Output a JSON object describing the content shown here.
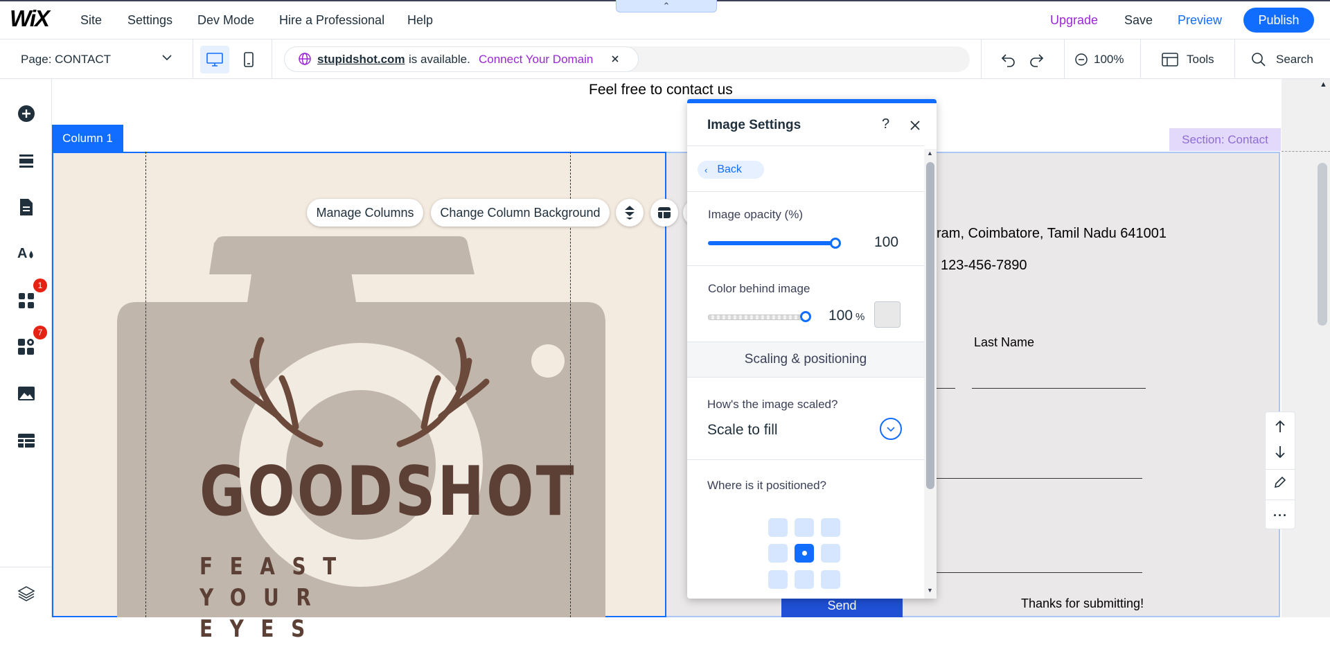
{
  "topbar": {
    "logo": "WiX",
    "menu": [
      "Site",
      "Settings",
      "Dev Mode",
      "Hire a Professional",
      "Help"
    ],
    "upgrade": "Upgrade",
    "save": "Save",
    "preview": "Preview",
    "publish": "Publish"
  },
  "subbar": {
    "page_label": "Page: CONTACT",
    "domain_name": "stupidshot.com",
    "domain_status": "is available.",
    "connect_domain": "Connect Your Domain",
    "zoom": "100%",
    "tools": "Tools",
    "search": "Search"
  },
  "sidebar": {
    "badges": {
      "apps": "1",
      "business": "7"
    }
  },
  "canvas": {
    "heading": "Feel free to contact us",
    "column_tag": "Column 1",
    "section_tag": "Section: Contact",
    "manage_columns": "Manage Columns",
    "change_bg": "Change Column Background",
    "address": "ram, Coimbatore, Tamil Nadu 641001",
    "phone": "123-456-7890",
    "last_name": "Last Name",
    "send": "Send",
    "thanks": "Thanks for submitting!"
  },
  "panel": {
    "title": "Image Settings",
    "help": "?",
    "back": "Back",
    "opacity_label": "Image opacity (%)",
    "opacity_value": "100",
    "opacity_fraction": 1.0,
    "color_label": "Color behind image",
    "color_value": "100",
    "color_unit": "%",
    "scaling_header": "Scaling & positioning",
    "scaled_q": "How's the image scaled?",
    "scaled_value": "Scale to fill",
    "position_q": "Where is it positioned?",
    "position_selected": "center"
  },
  "colors": {
    "accent": "#116dff",
    "upgrade": "#9a27d5",
    "column_bg": "#f4ebe0",
    "logo_brown": "#5c4036",
    "camera_gray": "#c1b6ac"
  }
}
